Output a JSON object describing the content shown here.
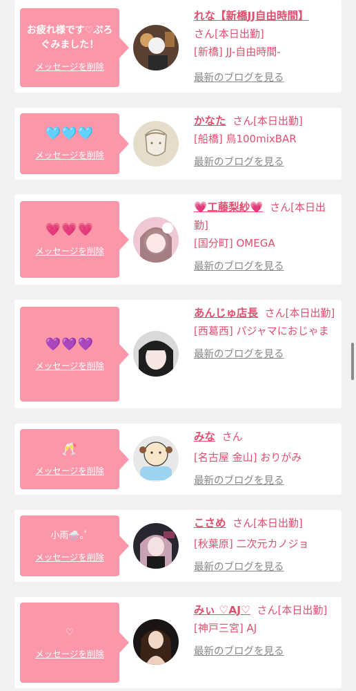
{
  "delete_label": "メッセージを削除",
  "blog_label": "最新のブログを見る",
  "cards": [
    {
      "message": "お疲れ様です♡ぷろぐみました！",
      "name": "れな【新橋JJ自由時間】",
      "suffix": "さん[本日出勤]",
      "store": "[新橋] JJ-自由時間-"
    },
    {
      "message": "🩵🩵🩵",
      "name": "かなた",
      "suffix": "さん[本日出勤]",
      "store": "[船橋] 鳥100mixBAR"
    },
    {
      "message": "💗💗💗",
      "name": "💗工藤梨紗💗",
      "suffix": "さん[本日出勤]",
      "store": "[国分町] OMEGA"
    },
    {
      "message": "💜💜💜",
      "name": "あんじゅ店長",
      "suffix": "さん[本日出勤]",
      "store": "[西葛西] パジャマにおじゃま"
    },
    {
      "message": "🥂",
      "name": "みな",
      "suffix": "さん",
      "store": "[名古屋 金山] おりがみ"
    },
    {
      "message": "小雨🌨️｡ﾟ",
      "name": "こさめ",
      "suffix": "さん[本日出勤]",
      "store": "[秋葉原] 二次元カノジョ"
    },
    {
      "message": "♡",
      "name": "みぃ ♡AJ♡",
      "suffix": "さん[本日出勤]",
      "store": "[神戸三宮] AJ"
    }
  ]
}
